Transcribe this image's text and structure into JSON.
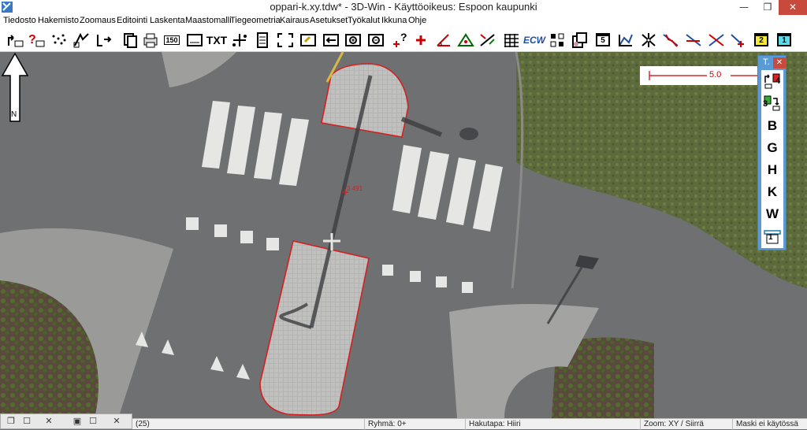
{
  "window": {
    "title": "oppari-k.xy.tdw* - 3D-Win - Käyttöoikeus: Espoon kaupunki",
    "minimize_glyph": "—",
    "maximize_glyph": "❐",
    "close_glyph": "✕"
  },
  "menu": [
    "Tiedosto",
    "Hakemisto",
    "Zoomaus",
    "Editointi",
    "Laskenta",
    "Maastomalli",
    "Tiegeometria",
    "Kairaus",
    "Asetukset",
    "Työkalut",
    "Ikkuna",
    "Ohje"
  ],
  "toolbar": {
    "scale_label": "150",
    "txt_label": "TXT",
    "ecw_label": "ECW",
    "number5_label": "5",
    "yellow2_label": "2",
    "teal1_label": "1"
  },
  "map": {
    "point_label": "3.491",
    "north_label": "N",
    "scale_value": "5.0"
  },
  "side_panel": {
    "title": "T.",
    "close_glyph": "✕",
    "items": [
      {
        "label": "4",
        "icon": "layer-up-icon"
      },
      {
        "label": "3",
        "icon": "layer-down-icon"
      },
      {
        "label": "B"
      },
      {
        "label": "G"
      },
      {
        "label": "H"
      },
      {
        "label": "K"
      },
      {
        "label": "W"
      },
      {
        "label": "1",
        "icon": "ruler-icon"
      }
    ]
  },
  "statusbar": {
    "coords": "(25)",
    "group": "Ryhmä: 0+",
    "search_mode": "Hakutapa: Hiiri",
    "zoom": "Zoom: XY  /  Siirrä",
    "mask": "Maski ei käytössä"
  },
  "colors": {
    "selection_red": "#d42020",
    "road_gray": "#6f7072",
    "paving_light": "#b7b7b5",
    "grass_green": "#5d6b3c",
    "window_blue": "#5b9bd5",
    "close_red": "#c74a3c"
  }
}
